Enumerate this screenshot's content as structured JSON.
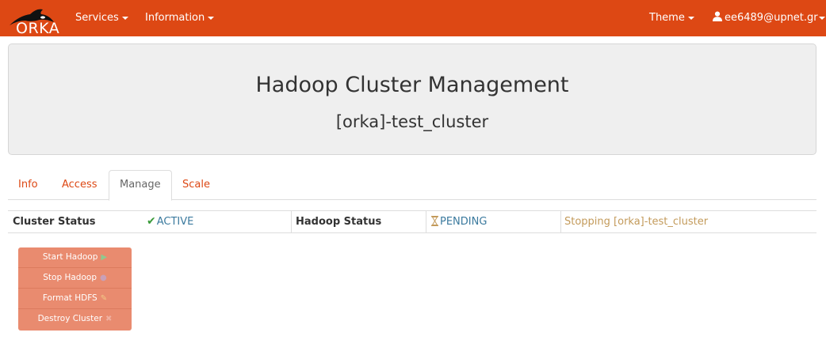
{
  "navbar": {
    "brand": "ORKA",
    "menus": [
      {
        "label": "Services"
      },
      {
        "label": "Information"
      }
    ],
    "theme_label": "Theme",
    "user_label": "ee6489@upnet.gr",
    "bg_color": "#dd4814"
  },
  "jumbotron": {
    "title": "Hadoop Cluster Management",
    "subtitle": "[orka]-test_cluster"
  },
  "tabs": [
    {
      "label": "Info",
      "active": false
    },
    {
      "label": "Access",
      "active": false
    },
    {
      "label": "Manage",
      "active": true
    },
    {
      "label": "Scale",
      "active": false
    }
  ],
  "status": {
    "cluster_label": "Cluster Status",
    "cluster_value": "ACTIVE",
    "hadoop_label": "Hadoop Status",
    "hadoop_value": "PENDING",
    "message": "Stopping [orka]-test_cluster"
  },
  "actions": [
    {
      "label": "Start Hadoop",
      "icon": "play-icon"
    },
    {
      "label": "Stop Hadoop",
      "icon": "stop-icon"
    },
    {
      "label": "Format HDFS",
      "icon": "format-icon"
    },
    {
      "label": "Destroy Cluster",
      "icon": "trash-icon"
    }
  ]
}
